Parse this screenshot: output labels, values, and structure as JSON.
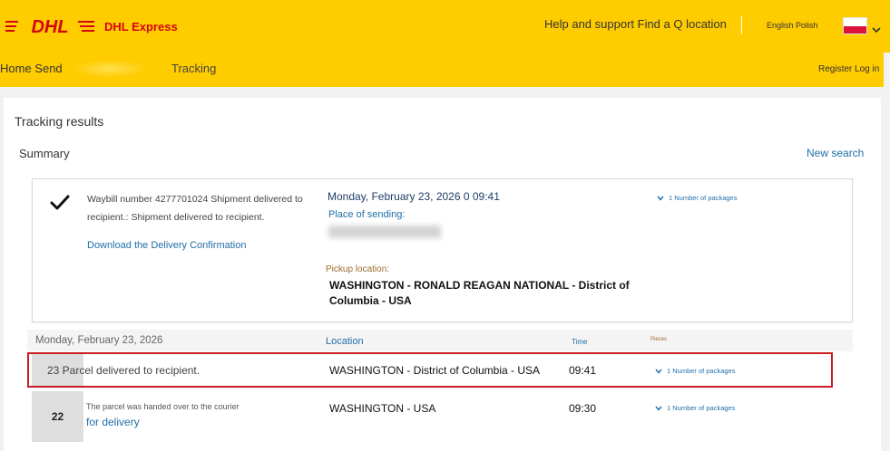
{
  "header": {
    "brand_logo": "DHL",
    "brand_name": "DHL Express",
    "help_link": "Help and support Find a Q location",
    "language_switch": "English Polish",
    "flag_colors": [
      "#ffffff",
      "#dc143c"
    ],
    "accent_color": "#ffcc00",
    "brand_color": "#d40511"
  },
  "nav": {
    "home_send": "Home Send",
    "tracking": "Tracking",
    "register_login": "Register Log in"
  },
  "results": {
    "title": "Tracking results",
    "summary_title": "Summary",
    "new_search": "New search"
  },
  "summary": {
    "status_icon": "checkmark-icon",
    "waybill_text": "Waybill number 4277701024 Shipment delivered to recipient.: Shipment delivered to recipient.",
    "download_link": "Download the Delivery Confirmation",
    "date_time": "Monday, February 23, 2026 0 09:41",
    "place_label": "Place of sending:",
    "pickup_label": "Pickup location:",
    "pickup_value": "WASHINGTON - RONALD REAGAN NATIONAL - District of Columbia - USA",
    "packages_toggle": "1 Number of packages"
  },
  "events": {
    "date_header": "Monday, February 23, 2026",
    "col_location": "Location",
    "col_time": "Time",
    "col_pieces": "Pieces",
    "rows": [
      {
        "description": "23 Parcel delivered to recipient.",
        "location": "WASHINGTON - District of Columbia - USA",
        "time": "09:41",
        "packages": "1 Number of packages"
      },
      {
        "day": "22",
        "description_line1": "The parcel was handed over to the courier",
        "description_line2": "for delivery",
        "location": "WASHINGTON - USA",
        "time": "09:30",
        "packages": "1 Number of packages"
      }
    ]
  }
}
